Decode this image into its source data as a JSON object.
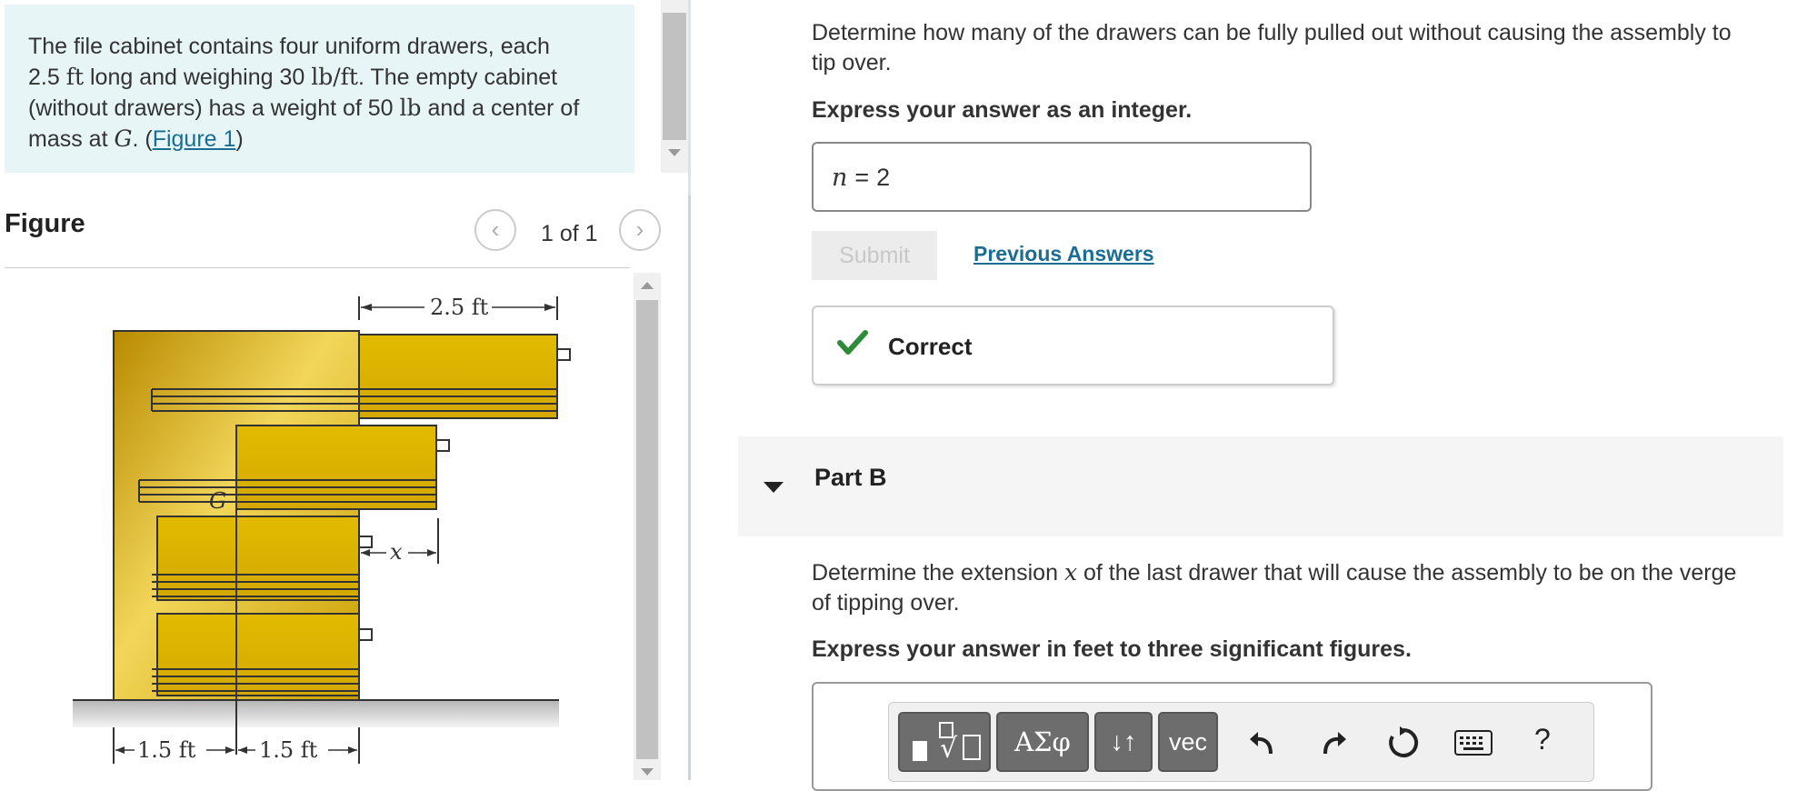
{
  "problem": {
    "text_1": "The file cabinet contains four uniform drawers, each",
    "val_length": "2.5",
    "unit_ft": "ft",
    "text_2": "long and weighing 30",
    "unit_lbft": "lb/ft",
    "text_3": ". The empty cabinet",
    "text_4": "(without drawers) has a weight of 50",
    "unit_lb": "lb",
    "text_5": "and a center of",
    "text_6": "mass at",
    "var_g": "G",
    "text_7": ". (",
    "figure_link": "Figure 1",
    "text_8": ")"
  },
  "figure": {
    "title": "Figure",
    "counter": "1 of 1",
    "labels": {
      "length_top": "2.5 ft",
      "g": "G",
      "x": "x",
      "dim_left": "1.5 ft",
      "dim_right": "1.5 ft"
    }
  },
  "part_a": {
    "question_1": "Determine how many of the drawers can be fully pulled out without causing the assembly to",
    "question_2": "tip over.",
    "instruction": "Express your answer as an integer.",
    "answer_var": "n",
    "answer_eq": "=",
    "answer_value": "2",
    "submit_label": "Submit",
    "previous_answers": "Previous Answers",
    "feedback": "Correct"
  },
  "part_b": {
    "title": "Part B",
    "question_1a": "Determine the extension",
    "question_var": "x",
    "question_1b": "of the last drawer that will cause the assembly to be on the verge",
    "question_2": "of tipping over.",
    "instruction": "Express your answer in feet to three significant figures.",
    "toolbar": {
      "greek_label": "ΑΣφ",
      "arrows_label": "↓↑",
      "vec_label": "vec",
      "help_label": "?"
    }
  },
  "colors": {
    "accent_link": "#1a6e93",
    "correct_green": "#2e8b3a",
    "problem_bg": "#e7f5f7",
    "drawer_gold": "#d9b000"
  }
}
